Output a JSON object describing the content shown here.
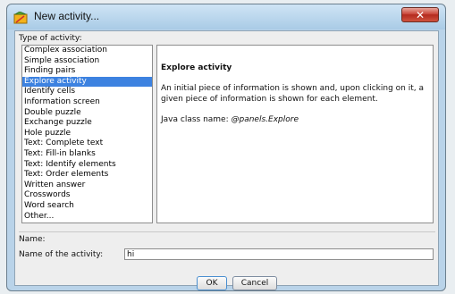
{
  "window": {
    "title": "New activity...",
    "close_glyph": "✕"
  },
  "type_section": {
    "label": "Type of activity:",
    "items": [
      "Complex association",
      "Simple association",
      "Finding pairs",
      "Explore activity",
      "Identify cells",
      "Information screen",
      "Double puzzle",
      "Exchange puzzle",
      "Hole puzzle",
      "Text: Complete text",
      "Text: Fill-in blanks",
      "Text: Identify elements",
      "Text: Order elements",
      "Written answer",
      "Crosswords",
      "Word search",
      "Other..."
    ],
    "selected": "Explore activity"
  },
  "description": {
    "title": "Explore activity",
    "body": "An initial piece of information is shown and, upon clicking on it, a given piece of information is shown for each element.",
    "class_prefix": "Java class name: ",
    "class_name": "@panels.Explore"
  },
  "name_section": {
    "label": "Name:",
    "field_label": "Name of the activity:",
    "value": "hi"
  },
  "buttons": {
    "ok": "OK",
    "cancel": "Cancel"
  },
  "colors": {
    "selection": "#3d82e0",
    "close_button": "#c9473a"
  },
  "icons": {
    "app": "new-activity-icon",
    "close": "close-icon"
  }
}
